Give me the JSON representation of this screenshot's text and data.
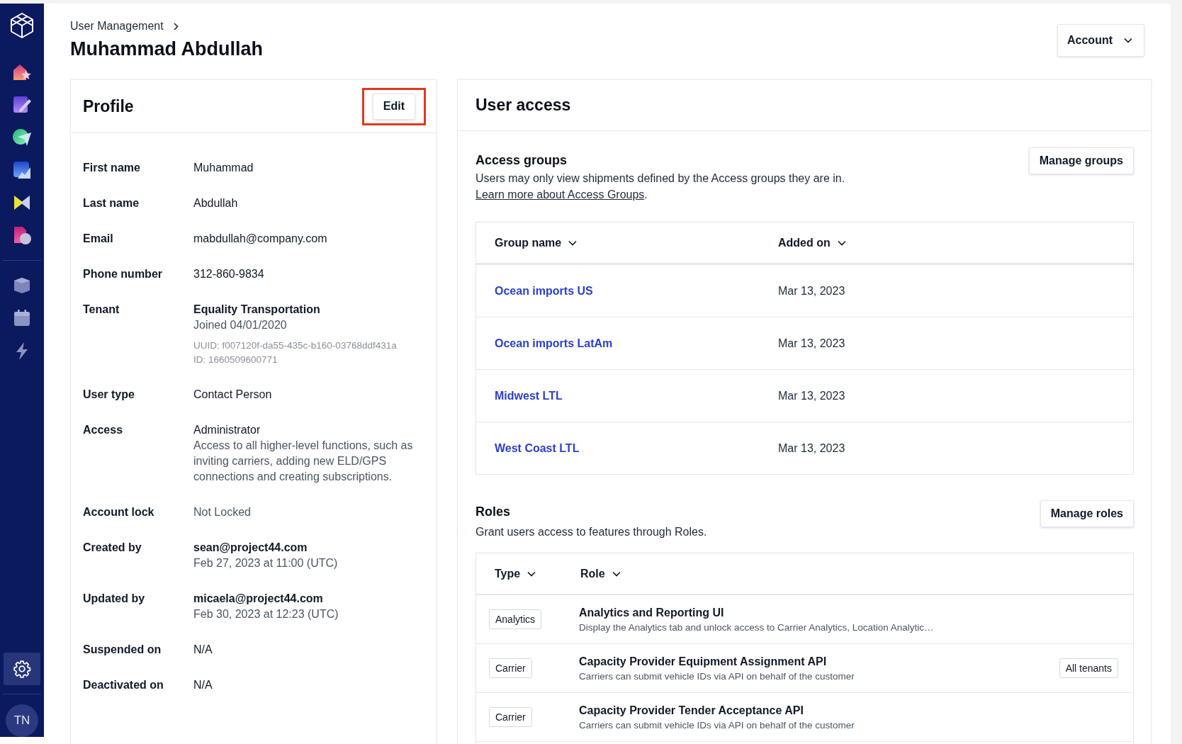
{
  "sidebar": {
    "items": [
      {
        "selected": false
      },
      {
        "selected": false
      },
      {
        "selected": false
      },
      {
        "selected": false
      },
      {
        "selected": false
      },
      {
        "selected": false
      },
      {
        "selected": false
      },
      {
        "selected": false
      },
      {
        "selected": false
      },
      {
        "selected": true
      }
    ],
    "avatar": "TN"
  },
  "breadcrumb": "User Management",
  "title": "Muhammad Abdullah",
  "account_button": "Account",
  "profile": {
    "title": "Profile",
    "edit_button": {
      "label": "Edit",
      "highlighted": true
    },
    "fields": [
      {
        "label": "First name",
        "lines": [
          {
            "text": "Muhammad",
            "kind": "plain"
          }
        ]
      },
      {
        "label": "Last name",
        "lines": [
          {
            "text": "Abdullah",
            "kind": "plain"
          }
        ]
      },
      {
        "label": "Email",
        "lines": [
          {
            "text": "mabdullah@company.com",
            "kind": "plain"
          }
        ]
      },
      {
        "label": "Phone number",
        "lines": [
          {
            "text": "312-860-9834",
            "kind": "plain"
          }
        ]
      },
      {
        "label": "Tenant",
        "lines": [
          {
            "text": "Equality Transportation",
            "kind": "strong"
          },
          {
            "text": "Joined 04/01/2020",
            "kind": "secondary"
          },
          {
            "text": "UUID: f007120f-da55-435c-b160-03768ddf431a",
            "kind": "meta"
          },
          {
            "text": "ID: 1660509600771",
            "kind": "meta"
          }
        ]
      },
      {
        "label": "User type",
        "lines": [
          {
            "text": "Contact Person",
            "kind": "plain"
          }
        ]
      },
      {
        "label": "Access",
        "lines": [
          {
            "text": "Administrator",
            "kind": "plain"
          },
          {
            "text": "Access to all higher-level functions, such as inviting carriers, adding new ELD/GPS connections and creating subscriptions.",
            "kind": "secondary"
          }
        ]
      },
      {
        "label": "Account lock",
        "lines": [
          {
            "text": "Not Locked",
            "kind": "secondary"
          }
        ]
      },
      {
        "label": "Created by",
        "lines": [
          {
            "text": "sean@project44.com",
            "kind": "strong"
          },
          {
            "text": "Feb 27, 2023 at 11:00 (UTC)",
            "kind": "secondary"
          }
        ]
      },
      {
        "label": "Updated by",
        "lines": [
          {
            "text": "micaela@project44.com",
            "kind": "strong"
          },
          {
            "text": "Feb 30, 2023 at 12:23 (UTC)",
            "kind": "secondary"
          }
        ]
      },
      {
        "label": "Suspended on",
        "lines": [
          {
            "text": "N/A",
            "kind": "plain"
          }
        ]
      },
      {
        "label": "Deactivated on",
        "lines": [
          {
            "text": "N/A",
            "kind": "plain"
          }
        ]
      }
    ]
  },
  "user_access": {
    "title": "User access",
    "access_groups": {
      "title": "Access groups",
      "description": "Users may only view shipments defined by the Access groups they are in.",
      "link": "Learn more about Access Groups",
      "link_suffix": ".",
      "button": "Manage groups",
      "columns": [
        "Group name",
        "Added on"
      ],
      "rows": [
        {
          "group": "Ocean imports US",
          "added_on": "Mar 13, 2023"
        },
        {
          "group": "Ocean imports LatAm",
          "added_on": "Mar 13, 2023"
        },
        {
          "group": "Midwest LTL",
          "added_on": "Mar 13, 2023"
        },
        {
          "group": "West Coast LTL",
          "added_on": "Mar 13, 2023"
        }
      ]
    },
    "roles": {
      "title": "Roles",
      "description": "Grant users access to features through Roles.",
      "button": "Manage roles",
      "columns": [
        "Type",
        "Role"
      ],
      "rows": [
        {
          "type": "Analytics",
          "name": "Analytics and Reporting UI",
          "description": "Display the Analytics tab and unlock access to Carrier Analytics, Location Analytic…"
        },
        {
          "type": "Carrier",
          "name": "Capacity Provider Equipment Assignment API",
          "description": "Carriers can submit vehicle IDs via API on behalf of the customer",
          "scope": "All tenants"
        },
        {
          "type": "Carrier",
          "name": "Capacity Provider Tender Acceptance API",
          "description": "Carriers can submit vehicle IDs via API on behalf of the customer"
        }
      ]
    }
  }
}
